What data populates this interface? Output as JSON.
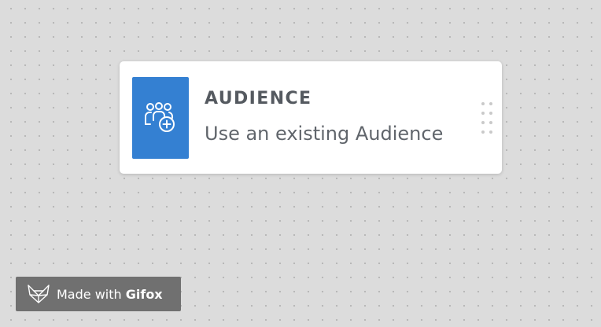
{
  "node": {
    "icon": "audience-add-icon",
    "title": "AUDIENCE",
    "subtitle": "Use an existing Audience",
    "accent_color": "#3480d2"
  },
  "watermark": {
    "icon": "gifox-fox-logo",
    "prefix": "Made with",
    "brand": "Gifox"
  }
}
